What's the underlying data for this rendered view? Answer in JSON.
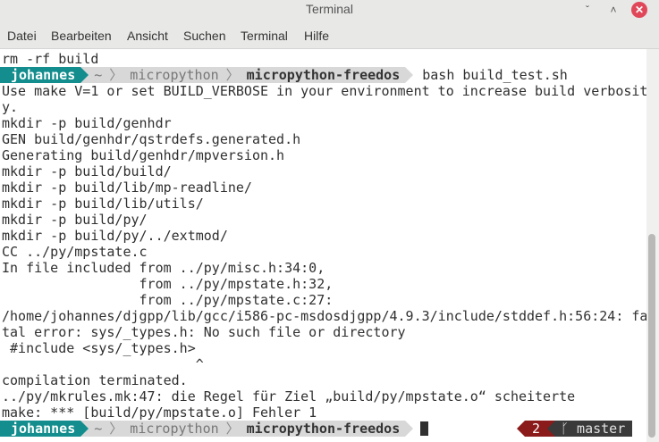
{
  "window": {
    "title": "Terminal",
    "minimize": "ˇ",
    "maximize": "˄",
    "close": "✕"
  },
  "menu": [
    "Datei",
    "Bearbeiten",
    "Ansicht",
    "Suchen",
    "Terminal",
    "Hilfe"
  ],
  "prompt": {
    "user": "johannes",
    "home": "~",
    "sep": "〉",
    "dir1": "micropython",
    "dir2": "micropython-freedos",
    "command": "bash build_test.sh"
  },
  "output": [
    "rm -rf build",
    "",
    "Use make V=1 or set BUILD_VERBOSE in your environment to increase build verbosit",
    "y.",
    "mkdir -p build/genhdr",
    "GEN build/genhdr/qstrdefs.generated.h",
    "Generating build/genhdr/mpversion.h",
    "mkdir -p build/build/",
    "mkdir -p build/lib/mp-readline/",
    "mkdir -p build/lib/utils/",
    "mkdir -p build/py/",
    "mkdir -p build/py/../extmod/",
    "CC ../py/mpstate.c",
    "In file included from ../py/misc.h:34:0,",
    "                 from ../py/mpstate.h:32,",
    "                 from ../py/mpstate.c:27:",
    "/home/johannes/djgpp/lib/gcc/i586-pc-msdosdjgpp/4.9.3/include/stddef.h:56:24: fa",
    "tal error: sys/_types.h: No such file or directory",
    " #include <sys/_types.h>",
    "                        ^",
    "compilation terminated.",
    "../py/mkrules.mk:47: die Regel für Ziel „build/py/mpstate.o“ scheiterte",
    "make: *** [build/py/mpstate.o] Fehler 1"
  ],
  "rprompt": {
    "jobs": "2",
    "git": "ᚴ master"
  }
}
